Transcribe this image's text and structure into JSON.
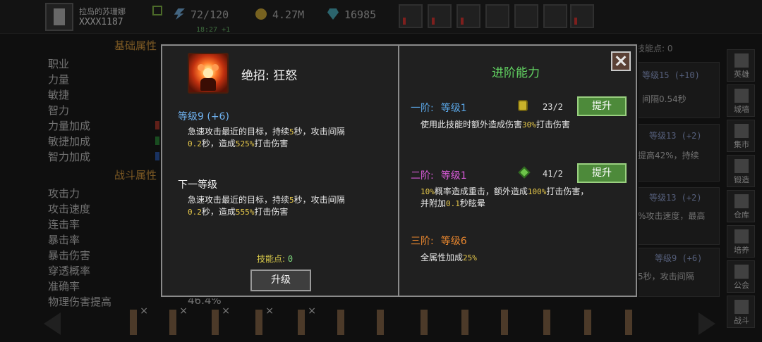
{
  "top": {
    "player_name": "拉岛的苏珊娜",
    "player_id": "XXXX1187",
    "energy": "72/120",
    "gold": "4.27M",
    "gems": "16985",
    "timer": "18:27 +1"
  },
  "left_panel": {
    "base_title": "基础属性",
    "base_attrs": [
      "职业",
      "力量",
      "敏捷",
      "智力",
      "力量加成",
      "敏捷加成",
      "智力加成"
    ],
    "battle_title": "战斗属性",
    "battle_attrs": [
      "攻击力",
      "攻击速度",
      "连击率",
      "暴击率",
      "暴击伤害",
      "穿透概率",
      "准确率",
      "物理伤害提高"
    ],
    "last_value": "46.4%"
  },
  "right_bg": {
    "header_skillpoints": "技能点: 0",
    "cards": [
      {
        "level": "等级15 (+10)",
        "text": "间隔0.54秒"
      },
      {
        "level": "等级13 (+2)",
        "text": "提高42%，持续"
      },
      {
        "level": "等级13 (+2)",
        "text": "%攻击速度，最高"
      },
      {
        "level": "等级9 (+6)",
        "text": "5秒，攻击间隔"
      }
    ]
  },
  "sidenav": [
    "英雄",
    "城墙",
    "集市",
    "锻造",
    "仓库",
    "培养",
    "公会",
    "战斗"
  ],
  "modal": {
    "skill_name": "绝招: 狂怒",
    "current_level": "等级9 (+6)",
    "current_desc": {
      "p1": "急速攻击最近的目标，持续",
      "duration": "5",
      "p2": "秒，攻击间隔",
      "interval": "0.2",
      "p3": "秒，造成",
      "damage": "525%",
      "p4": "打击伤害"
    },
    "next_label": "下一等级",
    "next_desc": {
      "p1": "急速攻击最近的目标，持续",
      "duration": "5",
      "p2": "秒，攻击间隔",
      "interval": "0.2",
      "p3": "秒，造成",
      "damage": "555%",
      "p4": "打击伤害"
    },
    "skill_points_label": "技能点: ",
    "skill_points_value": "0",
    "upgrade_label": "升级",
    "advanced_title": "进阶能力",
    "tiers": [
      {
        "name": "一阶:",
        "level": "等级1",
        "color": "#5aa6e6",
        "cost": "23/2",
        "button": "提升",
        "desc_parts": [
          "使用此技能时额外造成伤害",
          "30%",
          "打击伤害"
        ]
      },
      {
        "name": "二阶:",
        "level": "等级1",
        "color": "#d65ad6",
        "cost": "41/2",
        "button": "提升",
        "desc_parts": [
          "10%",
          "概率造成重击，额外造成",
          "100%",
          "打击伤害，",
          "并附加",
          "0.1",
          "秒眩晕"
        ]
      },
      {
        "name": "三阶:",
        "level": "等级6",
        "color": "#e8862e",
        "desc_parts": [
          "全属性加成",
          "25%"
        ]
      }
    ]
  }
}
